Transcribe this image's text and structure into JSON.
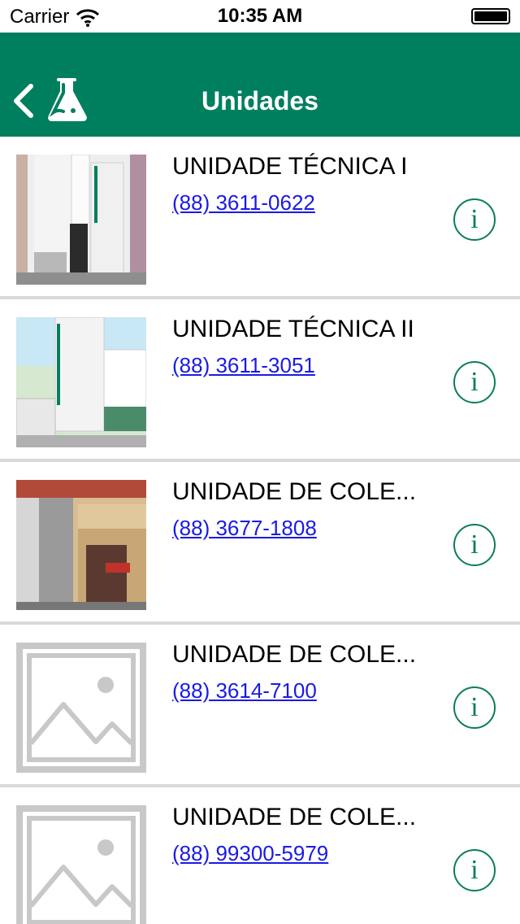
{
  "status_bar": {
    "carrier": "Carrier",
    "time": "10:35 AM"
  },
  "nav": {
    "title": "Unidades"
  },
  "colors": {
    "brand": "#007f5f",
    "link": "#1a1ae6",
    "separator": "#d9d9d9"
  },
  "units": [
    {
      "title": "UNIDADE TÉCNICA I",
      "phone": "(88) 3611-0622",
      "image": "photo"
    },
    {
      "title": "UNIDADE TÉCNICA II",
      "phone": "(88) 3611-3051",
      "image": "photo"
    },
    {
      "title": "UNIDADE DE COLE...",
      "phone": "(88) 3677-1808",
      "image": "photo"
    },
    {
      "title": "UNIDADE DE COLE...",
      "phone": "(88) 3614-7100",
      "image": "image-placeholder-icon"
    },
    {
      "title": "UNIDADE DE COLE...",
      "phone": "(88) 99300-5979",
      "image": "image-placeholder-icon"
    }
  ],
  "icons": {
    "info": "i"
  }
}
